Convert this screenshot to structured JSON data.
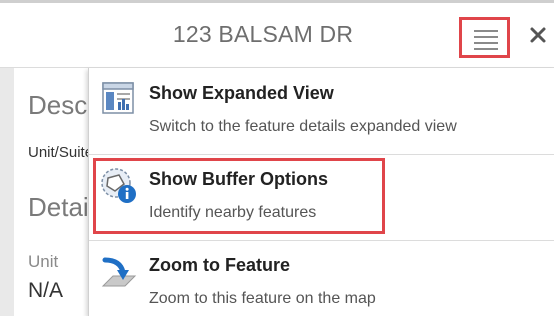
{
  "header": {
    "title": "123 BALSAM DR"
  },
  "details": {
    "section1_title": "Description",
    "field_unit_suite": "Unit/Suite",
    "section2_title": "Details",
    "unit_label": "Unit",
    "unit_value": "N/A"
  },
  "menu": {
    "items": [
      {
        "label": "Show Expanded View",
        "description": "Switch to the feature details expanded view",
        "icon": "expanded-view-icon"
      },
      {
        "label": "Show Buffer Options",
        "description": "Identify nearby features",
        "icon": "buffer-options-icon"
      },
      {
        "label": "Zoom to Feature",
        "description": "Zoom to this feature on the map",
        "icon": "zoom-to-feature-icon"
      }
    ]
  },
  "colors": {
    "highlight": "#e0454a",
    "title_text": "#6e6e6e",
    "icon_blue": "#1f6fc5"
  }
}
